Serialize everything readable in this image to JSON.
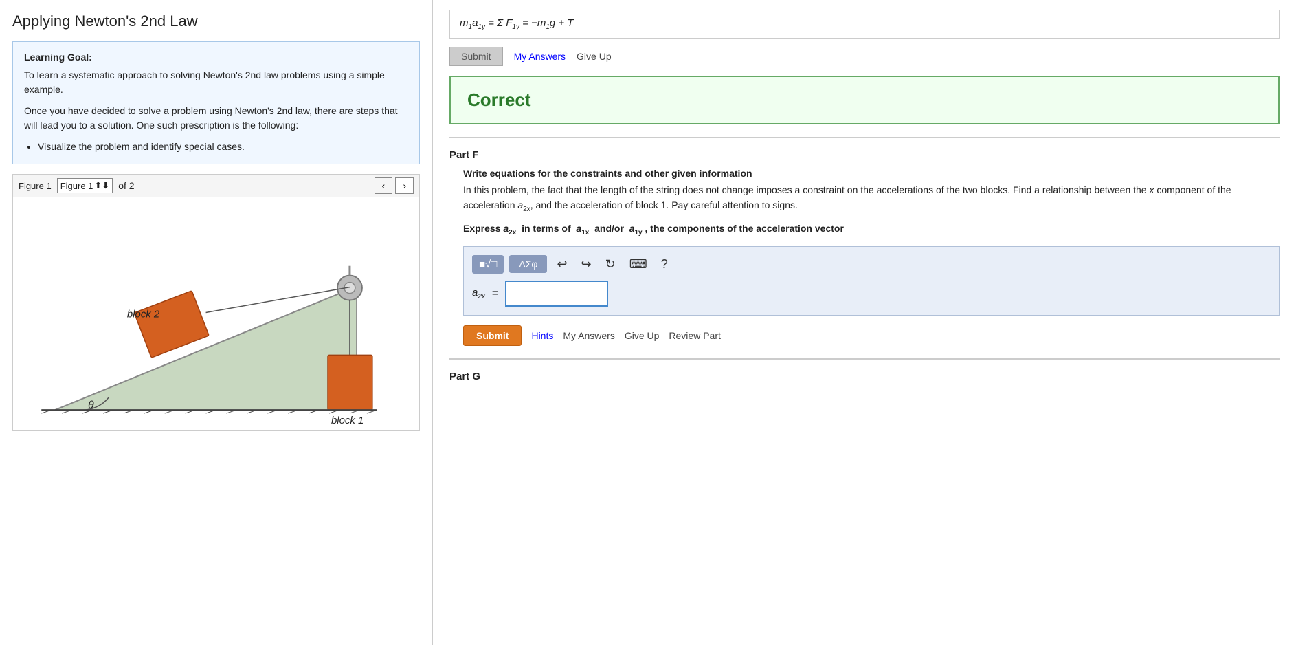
{
  "page": {
    "title": "Applying Newton's 2nd Law"
  },
  "left": {
    "learning_goal_title": "Learning Goal:",
    "learning_goal_p1": "To learn a systematic approach to solving Newton's 2nd law problems using a simple example.",
    "learning_goal_p2": "Once you have decided to solve a problem using Newton's 2nd law, there are steps that will lead you to a solution. One such prescription is the following:",
    "learning_goal_bullet": "Visualize the problem and identify special cases.",
    "figure_label": "Figure 1",
    "figure_of": "of 2",
    "block2_label": "block 2",
    "block1_label": "block 1",
    "theta_label": "θ"
  },
  "right": {
    "equation_display": "m₁a₁y = Σ F₁y = -m₁g + T",
    "submit_label": "Submit",
    "my_answers_label": "My Answers",
    "give_up_label": "Give Up",
    "correct_text": "Correct",
    "partF": {
      "header": "Part F",
      "subheader": "Write equations for the constraints and other given information",
      "description": "In this problem, the fact that the length of the string does not change imposes a constraint on the accelerations of the two blocks. Find a relationship between the x component of the acceleration a₂ₓ, and the acceleration of block 1. Pay careful attention to signs.",
      "express_line": "Express a₂ₓ  in terms of  a₁ₓ  and/or  a₁y , the components of the acceleration vector",
      "math_label": "a₂ₓ =",
      "submit_label": "Submit",
      "hints_label": "Hints",
      "my_answers_label": "My Answers",
      "give_up_label": "Give Up",
      "review_part_label": "Review Part"
    },
    "partG": {
      "header": "Part G"
    },
    "toolbar": {
      "templates_label": "√□",
      "symbols_label": "AΣφ",
      "undo_label": "↩",
      "redo_label": "↪",
      "refresh_label": "↺",
      "keyboard_label": "⌨",
      "help_label": "?"
    },
    "colors": {
      "correct_green": "#2a7a2a",
      "correct_bg": "#f0fff0",
      "correct_border": "#6aaa6a",
      "submit_orange": "#e07820",
      "link_blue": "#0000ee"
    }
  }
}
